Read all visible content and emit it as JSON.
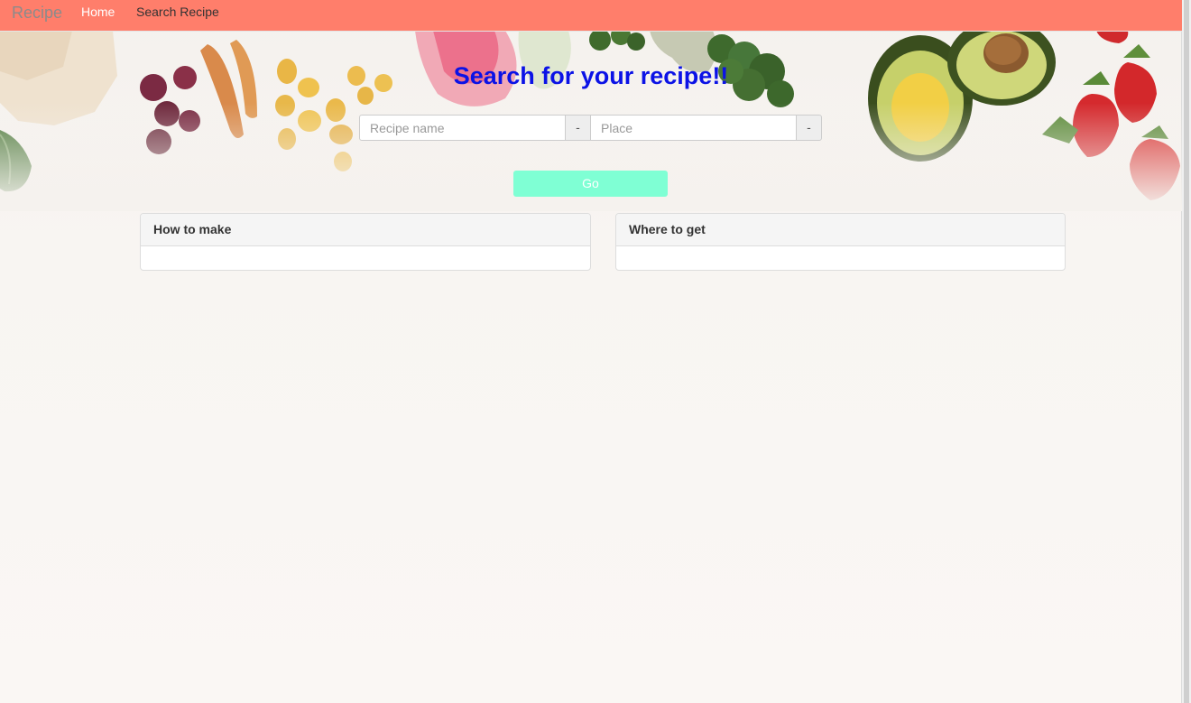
{
  "navbar": {
    "brand": "Recipe",
    "links": [
      {
        "label": "Home",
        "active": true
      },
      {
        "label": "Search Recipe",
        "active": false
      }
    ],
    "background_color": "#ff7e6b"
  },
  "main": {
    "title": "Search for your recipe!!",
    "title_color": "#0b12e6",
    "search": {
      "recipe_placeholder": "Recipe name",
      "recipe_value": "",
      "recipe_addon": "-",
      "place_placeholder": "Place",
      "place_value": "",
      "place_addon": "-"
    },
    "go_button": {
      "label": "Go",
      "color": "#7fffd4"
    },
    "panels": [
      {
        "heading": "How to make",
        "body": ""
      },
      {
        "heading": "Where to get",
        "body": ""
      }
    ]
  }
}
